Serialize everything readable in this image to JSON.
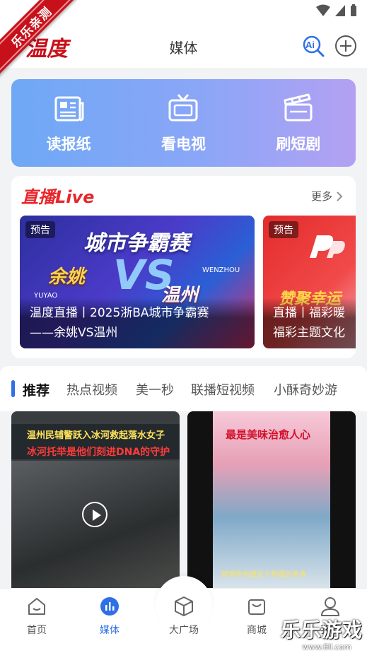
{
  "ribbon": {
    "text": "乐乐亲测"
  },
  "header": {
    "logo": "温度",
    "title": "媒体",
    "ai_label": "Ai"
  },
  "quick_actions": [
    {
      "label": "读报纸",
      "icon": "newspaper-icon"
    },
    {
      "label": "看电视",
      "icon": "tv-icon"
    },
    {
      "label": "刷短剧",
      "icon": "clapperboard-icon"
    }
  ],
  "live": {
    "title": "直播Live",
    "more": "更多",
    "items": [
      {
        "badge": "预告",
        "art_title": "城市争霸赛",
        "team_left": "余姚",
        "team_right": "温州",
        "vs": "VS",
        "sub_left": "YUYAO",
        "sub_right": "WENZHOU",
        "caption_line1": "温度直播丨2025浙BA城市争霸赛",
        "caption_line2": "——余姚VS温州"
      },
      {
        "badge": "预告",
        "art_title": "赞聚幸运",
        "caption_line1": "直播丨福彩暖",
        "caption_line2": "福彩主题文化"
      }
    ]
  },
  "tabs": [
    "推荐",
    "热点视频",
    "美一秒",
    "联播短视频",
    "小酥奇妙游"
  ],
  "feed": [
    {
      "caption_line1": "温州民辅警跃入冰河救起落水女子",
      "caption_line2": "冰河托举是他们刻进DNA的守护"
    },
    {
      "caption_line1": "最是美味治愈人心",
      "caption_line2": "就得吃地道这个新疆的美食"
    }
  ],
  "bottom_nav": [
    {
      "label": "首页",
      "icon": "home-icon"
    },
    {
      "label": "媒体",
      "icon": "media-icon",
      "active": true
    },
    {
      "label": "大广场",
      "icon": "cube-icon"
    },
    {
      "label": "商城",
      "icon": "mall-icon"
    },
    {
      "label": "我的",
      "icon": "profile-icon"
    }
  ],
  "watermark": {
    "text": "乐乐游戏",
    "url": "www.6ll.com"
  },
  "colors": {
    "accent": "#2f6fe8",
    "brand_red": "#c8101a"
  }
}
